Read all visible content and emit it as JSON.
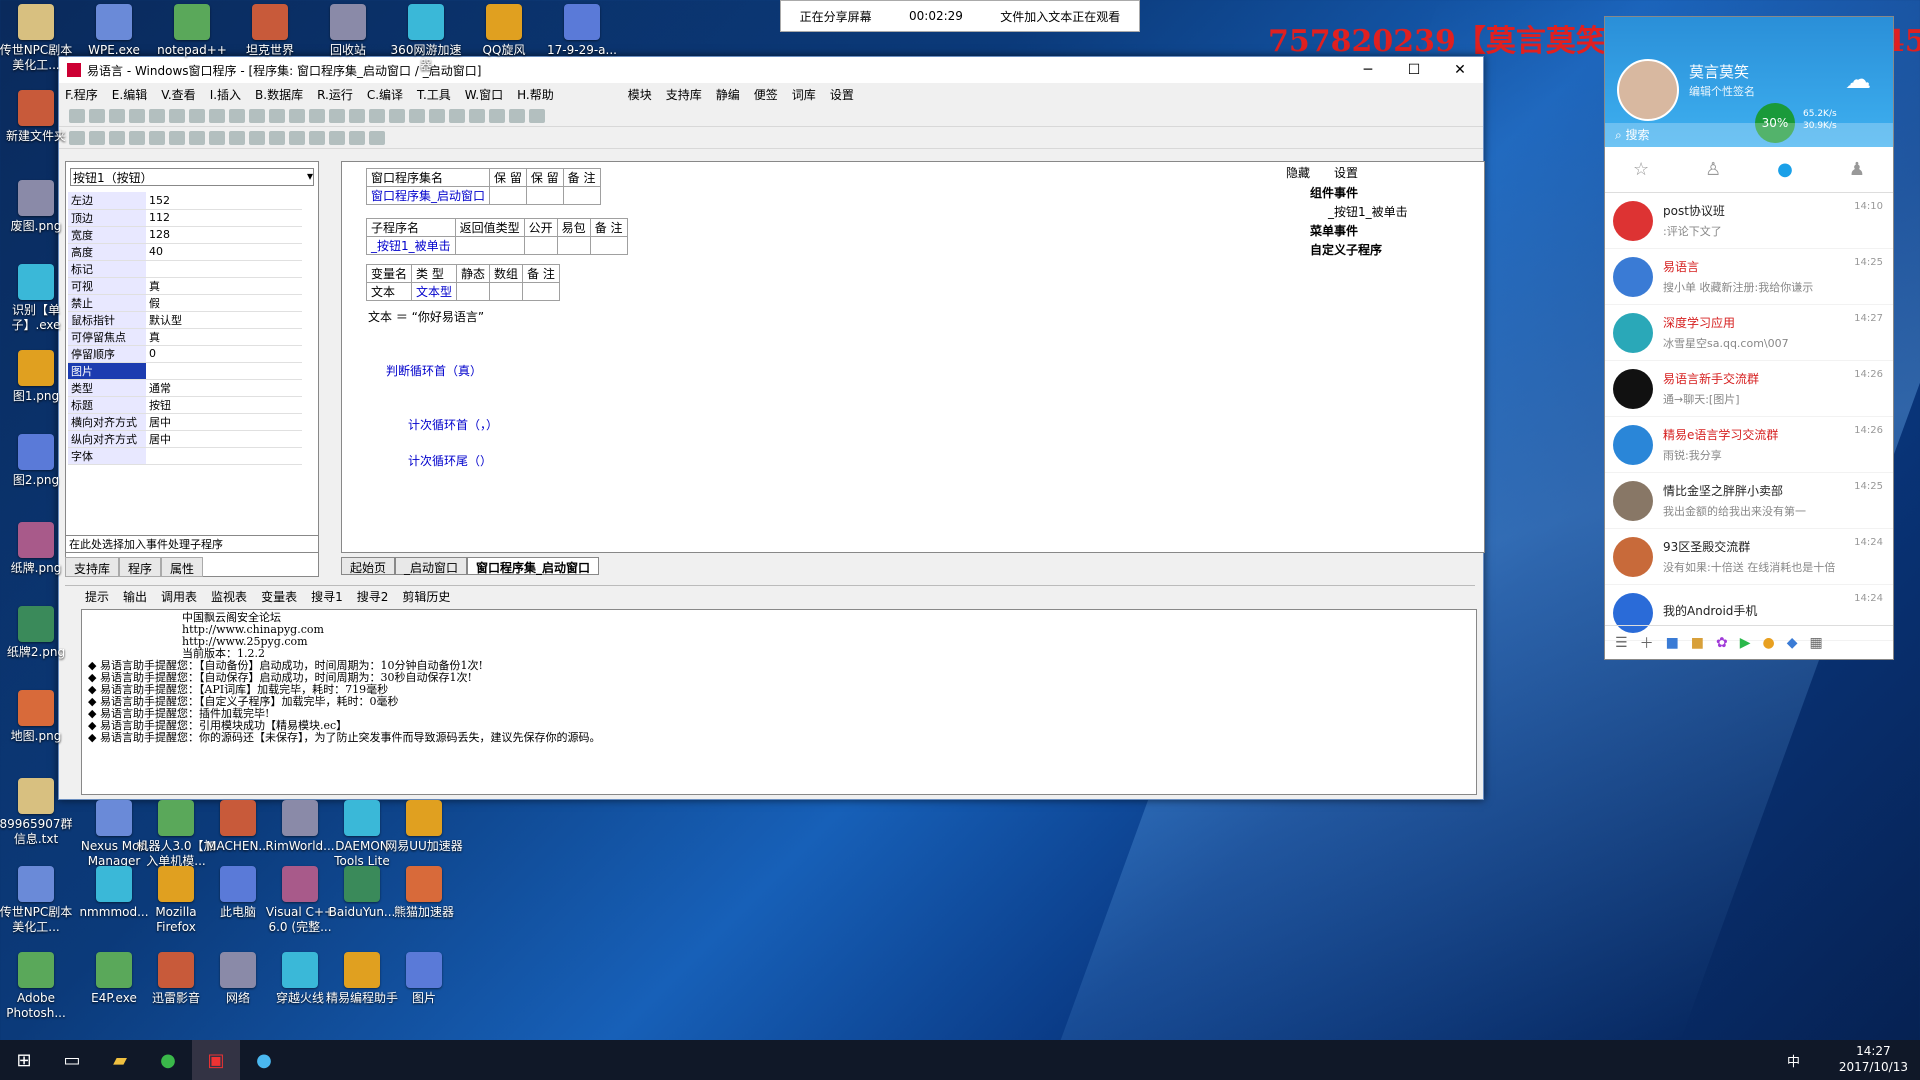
{
  "share": {
    "status": "正在分享屏幕",
    "timer": "00:02:29",
    "note": "文件加入文本正在观看"
  },
  "banner": {
    "text": "757820239【莫言莫笑】 QQ群：476905451"
  },
  "desktop": {
    "icons_top": [
      "传世NPC剧本美化工...",
      "WPE.exe",
      "notepad++",
      "坦克世界",
      "回收站",
      "360网游加速器",
      "QQ旋风",
      "17-9-29-a..."
    ],
    "icons_left": [
      "新建文件夹",
      "废图.png",
      "识别【单子】.exe",
      "图1.png",
      "图2.png",
      "纸牌.png",
      "纸牌2.png",
      "地图.png",
      "89965907群信息.txt",
      "传世NPC剧本美化工...",
      "Adobe Photosh..."
    ],
    "icons_row1": [
      "Nexus Mod Manager",
      "机器人3.0【加入单机模...",
      "MACHEN...",
      "RimWorld...",
      "DAEMON Tools Lite",
      "网易UU加速器"
    ],
    "icons_row2": [
      "nmmmod...",
      "Mozilla Firefox",
      "此电脑",
      "Visual C++ 6.0 (完整...",
      "BaiduYun...",
      "熊猫加速器"
    ],
    "icons_row3": [
      "E4P.exe",
      "迅雷影音",
      "网络",
      "穿越火线",
      "精易编程助手",
      "图片"
    ]
  },
  "window": {
    "title": "易语言 - Windows窗口程序 - [程序集: 窗口程序集_启动窗口 / _启动窗口]",
    "menu": [
      "F.程序",
      "E.编辑",
      "V.查看",
      "I.插入",
      "B.数据库",
      "R.运行",
      "C.编译",
      "T.工具",
      "W.窗口",
      "H.帮助"
    ],
    "menu_right": [
      "模块",
      "支持库",
      "静编",
      "便签",
      "词库",
      "设置"
    ]
  },
  "props": {
    "combo": "按钮1（按钮）",
    "rows": [
      {
        "k": "左边",
        "v": "152"
      },
      {
        "k": "顶边",
        "v": "112"
      },
      {
        "k": "宽度",
        "v": "128"
      },
      {
        "k": "高度",
        "v": "40"
      },
      {
        "k": "标记",
        "v": ""
      },
      {
        "k": "可视",
        "v": "真"
      },
      {
        "k": "禁止",
        "v": "假"
      },
      {
        "k": "鼠标指针",
        "v": "默认型"
      },
      {
        "k": "可停留焦点",
        "v": "真"
      },
      {
        "k": "停留顺序",
        "v": "0"
      },
      {
        "k": "图片",
        "v": ""
      },
      {
        "k": "类型",
        "v": "通常"
      },
      {
        "k": "标题",
        "v": "按钮"
      },
      {
        "k": "横向对齐方式",
        "v": "居中"
      },
      {
        "k": "纵向对齐方式",
        "v": "居中"
      },
      {
        "k": "字体",
        "v": ""
      }
    ],
    "event_combo": "在此处选择加入事件处理子程序",
    "tabs": [
      "支持库",
      "程序",
      "属性"
    ]
  },
  "editor": {
    "assembly_header": [
      "窗口程序集名",
      "保 留",
      "保 留",
      "备 注"
    ],
    "assembly_name": "窗口程序集_启动窗口",
    "sub_header": [
      "子程序名",
      "返回值类型",
      "公开",
      "易包",
      "备 注"
    ],
    "sub_name": "_按钮1_被单击",
    "var_header": [
      "变量名",
      "类 型",
      "静态",
      "数组",
      "备 注"
    ],
    "var_name": "文本",
    "var_type": "文本型",
    "line1": "文本 ＝ “你好易语言”",
    "line2": "判断循环首（真）",
    "line3": "计次循环首（，）",
    "line4": "计次循环尾（）",
    "tree_header": [
      "隐藏",
      "设置"
    ],
    "tree": [
      "组件事件",
      "_按钮1_被单击",
      "菜单事件",
      "自定义子程序"
    ],
    "tabs": [
      "起始页",
      "_启动窗口",
      "窗口程序集_启动窗口"
    ]
  },
  "output": {
    "tabs": [
      "提示",
      "输出",
      "调用表",
      "监视表",
      "变量表",
      "搜寻1",
      "搜寻2",
      "剪辑历史"
    ],
    "lines": [
      "中国飘云阁安全论坛",
      "http://www.chinapyg.com",
      "http://www.25pyg.com",
      "当前版本：1.2.2",
      "◆ 易语言助手提醒您：【自动备份】启动成功，时间周期为：10分钟自动备份1次!",
      "◆ 易语言助手提醒您：【自动保存】启动成功，时间周期为：30秒自动保存1次!",
      "◆ 易语言助手提醒您：【API词库】加载完毕，耗时：719毫秒",
      "◆ 易语言助手提醒您：【自定义子程序】加载完毕，耗时：0毫秒",
      "◆ 易语言助手提醒您：插件加载完毕!",
      "◆ 易语言助手提醒您：引用模块成功【精易模块.ec】",
      "◆ 易语言助手提醒您：你的源码还【未保存】，为了防止突发事件而导致源码丢失，建议先保存你的源码。"
    ]
  },
  "qq": {
    "name": "莫言莫笑",
    "signature": "编辑个性签名",
    "percent": "30%",
    "net_up": "65.2K/s",
    "net_down": "30.9K/s",
    "search": "搜索",
    "chats": [
      {
        "name": "post协议班",
        "msg": ":评论下文了",
        "time": "14:10",
        "color": "#d33",
        "red": false
      },
      {
        "name": "易语言",
        "msg": "搜小单 收藏新注册:我给你谦示",
        "time": "14:25",
        "color": "#3a7bd5",
        "red": true
      },
      {
        "name": "深度学习应用",
        "msg": "冰雪星空sa.qq.com\\007",
        "time": "14:27",
        "color": "#2aa8b8",
        "red": true
      },
      {
        "name": "易语言新手交流群",
        "msg": "通→聊天:[图片]",
        "time": "14:26",
        "color": "#111",
        "red": true
      },
      {
        "name": "精易e语言学习交流群",
        "msg": "雨锐:我分享",
        "time": "14:26",
        "color": "#2a86d8",
        "red": true
      },
      {
        "name": "情比金坚之胖胖小卖部",
        "msg": "我出金额的给我出来没有第一",
        "time": "14:25",
        "color": "#887766",
        "red": false
      },
      {
        "name": "93区圣殿交流群",
        "msg": "没有如果:十倍送 在线消耗也是十倍",
        "time": "14:24",
        "color": "#c86a3a",
        "red": false
      },
      {
        "name": "我的Android手机",
        "msg": "",
        "time": "14:24",
        "color": "#2a6bd8",
        "red": false
      }
    ]
  },
  "taskbar": {
    "time": "14:27",
    "date": "2017/10/13",
    "ime": "中"
  }
}
